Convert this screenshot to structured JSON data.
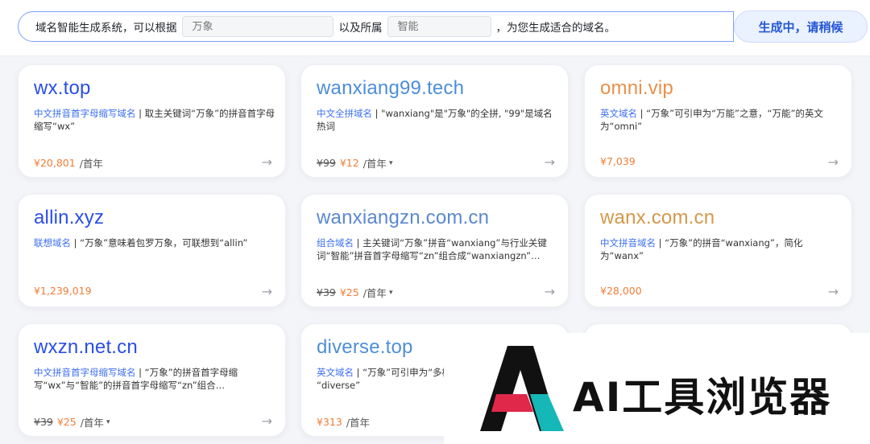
{
  "prompt": {
    "text1": "域名智能生成系统，可以根据",
    "field1_placeholder": "万象",
    "text2": "以及所属",
    "field2_placeholder": "智能",
    "text3": "，为您生成适合的域名。",
    "button_label": "生成中，请稍候"
  },
  "cards": [
    {
      "domain": "wx.top",
      "tag": "中文拼音首字母缩写域名",
      "desc": " | 取主关键词“万象”的拼音首字母缩写“wx”",
      "orig": "",
      "price": "¥20,801",
      "per": "/首年"
    },
    {
      "domain": "wanxiang99.tech",
      "tag": "中文全拼域名",
      "desc": " | \"wanxiang\"是\"万象\"的全拼, \"99\"是域名热词",
      "orig": "¥99",
      "price": "¥12",
      "per": "/首年"
    },
    {
      "domain": "omni.vip",
      "tag": "英文域名",
      "desc": " | “万象”可引申为“万能”之意，“万能”的英文为“omni”",
      "orig": "",
      "price": "¥7,039",
      "per": ""
    },
    {
      "domain": "allin.xyz",
      "tag": "联想域名",
      "desc": " | “万象”意味着包罗万象，可联想到“allin”",
      "orig": "",
      "price": "¥1,239,019",
      "per": ""
    },
    {
      "domain": "wanxiangzn.com.cn",
      "tag": "组合域名",
      "desc": " | 主关键词“万象”拼音“wanxiang”与行业关键词“智能”拼音首字母缩写“zn”组合成“wanxiangzn”…",
      "orig": "¥39",
      "price": "¥25",
      "per": "/首年"
    },
    {
      "domain": "wanx.com.cn",
      "tag": "中文拼音域名",
      "desc": " | “万象”的拼音“wanxiang”，简化为“wanx”",
      "orig": "",
      "price": "¥28,000",
      "per": ""
    },
    {
      "domain": "wxzn.net.cn",
      "tag": "中文拼音首字母缩写域名",
      "desc": " | “万象”的拼音首字母缩写“wx”与“智能”的拼音首字母缩写“zn”组合…",
      "orig": "¥39",
      "price": "¥25",
      "per": "/首年"
    },
    {
      "domain": "diverse.top",
      "tag": "英文域名",
      "desc": " | “万象”可引申为“多样",
      "desc2": "“diverse”",
      "orig": "",
      "price": "¥313",
      "per": "/首年"
    }
  ],
  "overlay": {
    "brand_text": "AI工具浏览器"
  },
  "colors": {
    "accent": "#2b4ee6",
    "price": "#f07d38",
    "tag": "#3b6ef0",
    "logo_black": "#111111",
    "logo_red": "#e0284a",
    "logo_teal": "#15b7b7"
  }
}
